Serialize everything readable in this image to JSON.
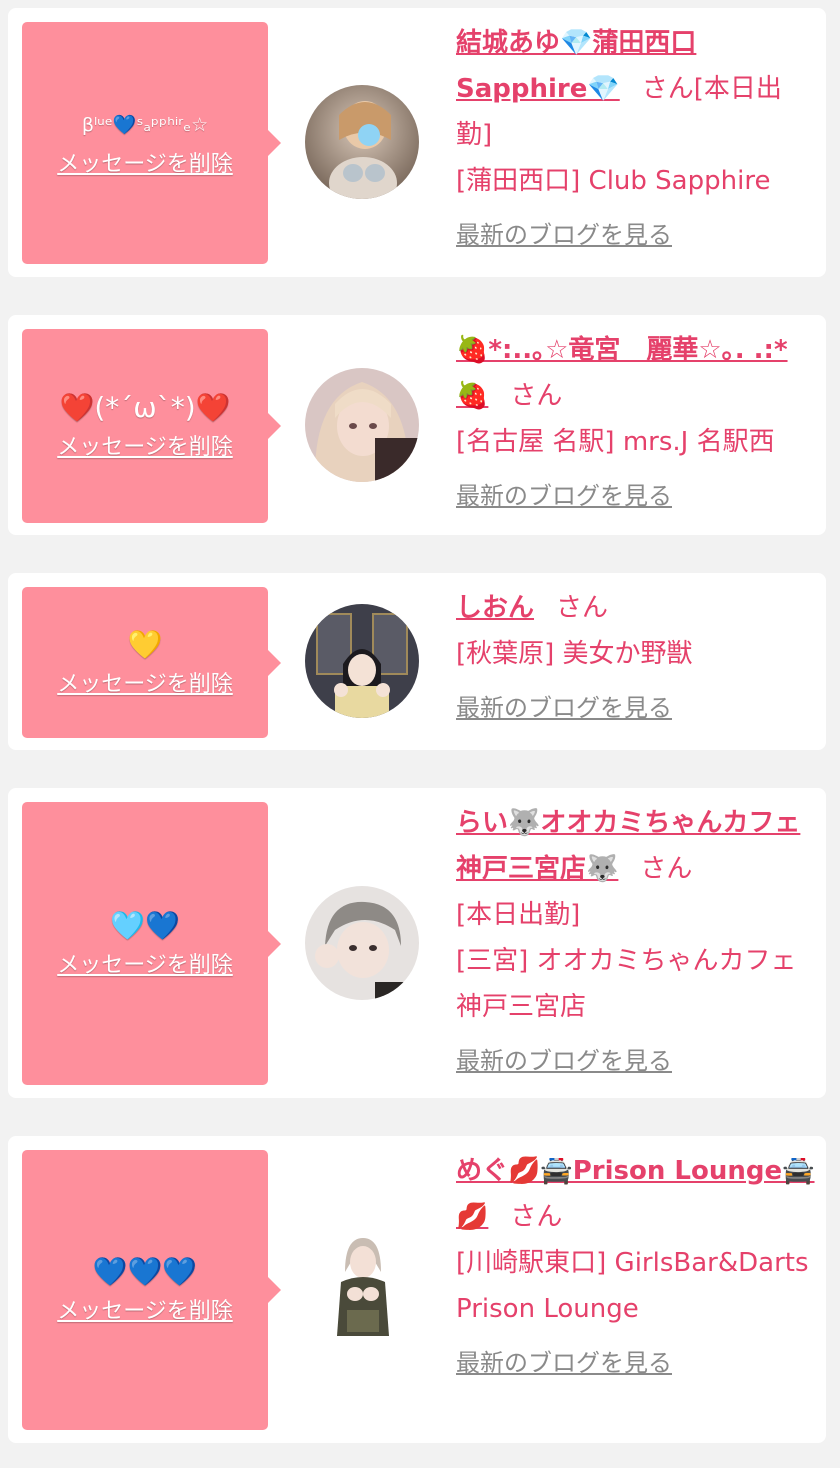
{
  "cards": [
    {
      "message": "βˡᵘᵉ💙ˢₐᵖᵖʰⁱʳₑ☆",
      "delete_label": "メッセージを削除",
      "name": "結城あゆ💎蒲田西口Sapphire💎",
      "san": "さん",
      "status": "[本日出勤]",
      "shop": "[蒲田西口] Club Sapphire",
      "blog_label": "最新のブログを見る"
    },
    {
      "message": "❤️(*´ω`*)❤️",
      "delete_label": "メッセージを削除",
      "name": "🍓*:..｡☆竜宮　麗華☆｡. .:*🍓",
      "san": "さん",
      "status": "",
      "shop": "[名古屋 名駅] mrs.J 名駅西",
      "blog_label": "最新のブログを見る"
    },
    {
      "message": "💛",
      "delete_label": "メッセージを削除",
      "name": "しおん",
      "san": "さん",
      "status": "",
      "shop": "[秋葉原] 美女か野獣",
      "blog_label": "最新のブログを見る"
    },
    {
      "message": "🩵💙",
      "delete_label": "メッセージを削除",
      "name": "らい🐺オオカミちゃんカフェ神戸三宮店🐺",
      "san": "さん",
      "status": "[本日出勤]",
      "shop": "[三宮] オオカミちゃんカフェ神戸三宮店",
      "blog_label": "最新のブログを見る"
    },
    {
      "message": "💙💙💙",
      "delete_label": "メッセージを削除",
      "name": "めぐ💋🚔Prison Lounge🚔💋",
      "san": "さん",
      "status": "",
      "shop": "[川崎駅東口] GirlsBar&Darts Prison Lounge",
      "blog_label": "最新のブログを見る"
    }
  ],
  "colors": {
    "bubble": "#fe8f9c",
    "accent_text": "#e5416b",
    "muted_link": "#8a8a8a",
    "page_bg": "#f2f2f2"
  }
}
